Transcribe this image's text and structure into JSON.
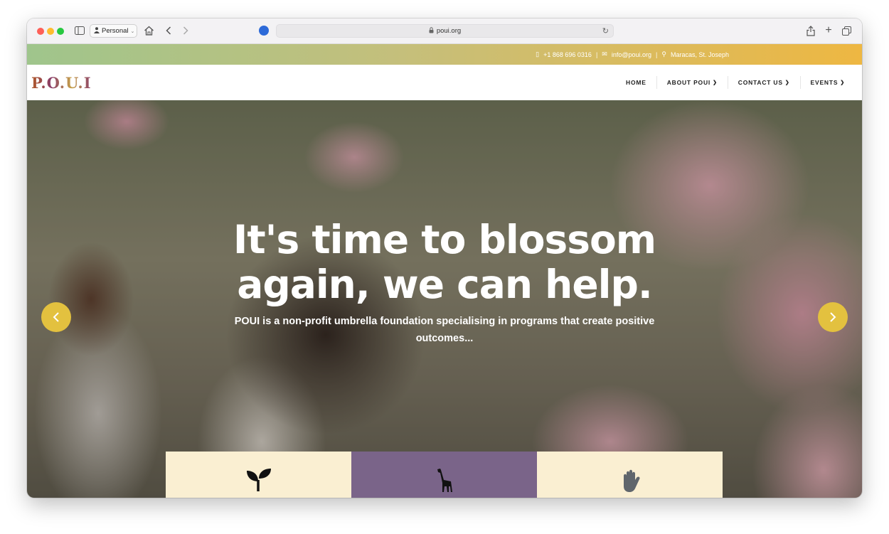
{
  "browser": {
    "profile_label": "Personal",
    "url": "poui.org"
  },
  "topbar": {
    "phone": "+1 868 696 0316",
    "email": "info@poui.org",
    "location": "Maracas, St. Joseph",
    "separator": "|"
  },
  "site": {
    "logo": "P.O.U.I"
  },
  "nav": {
    "items": [
      {
        "label": "HOME"
      },
      {
        "label": "ABOUT POUI"
      },
      {
        "label": "CONTACT US"
      },
      {
        "label": "EVENTS"
      }
    ]
  },
  "hero": {
    "title_line1": "It's time to blossom",
    "title_line2": "again, we can help.",
    "subtitle": "POUI is a non-profit umbrella foundation specialising in programs that create positive outcomes..."
  },
  "features": [
    {
      "icon": "sprout-icon",
      "bg": "#faefd2"
    },
    {
      "icon": "giraffe-icon",
      "bg": "#7a6489"
    },
    {
      "icon": "hand-icon",
      "bg": "#faefd2"
    }
  ],
  "colors": {
    "accent": "#e3c13f",
    "topbar_gradient_start": "#9fc58c",
    "topbar_gradient_end": "#eeb742"
  }
}
